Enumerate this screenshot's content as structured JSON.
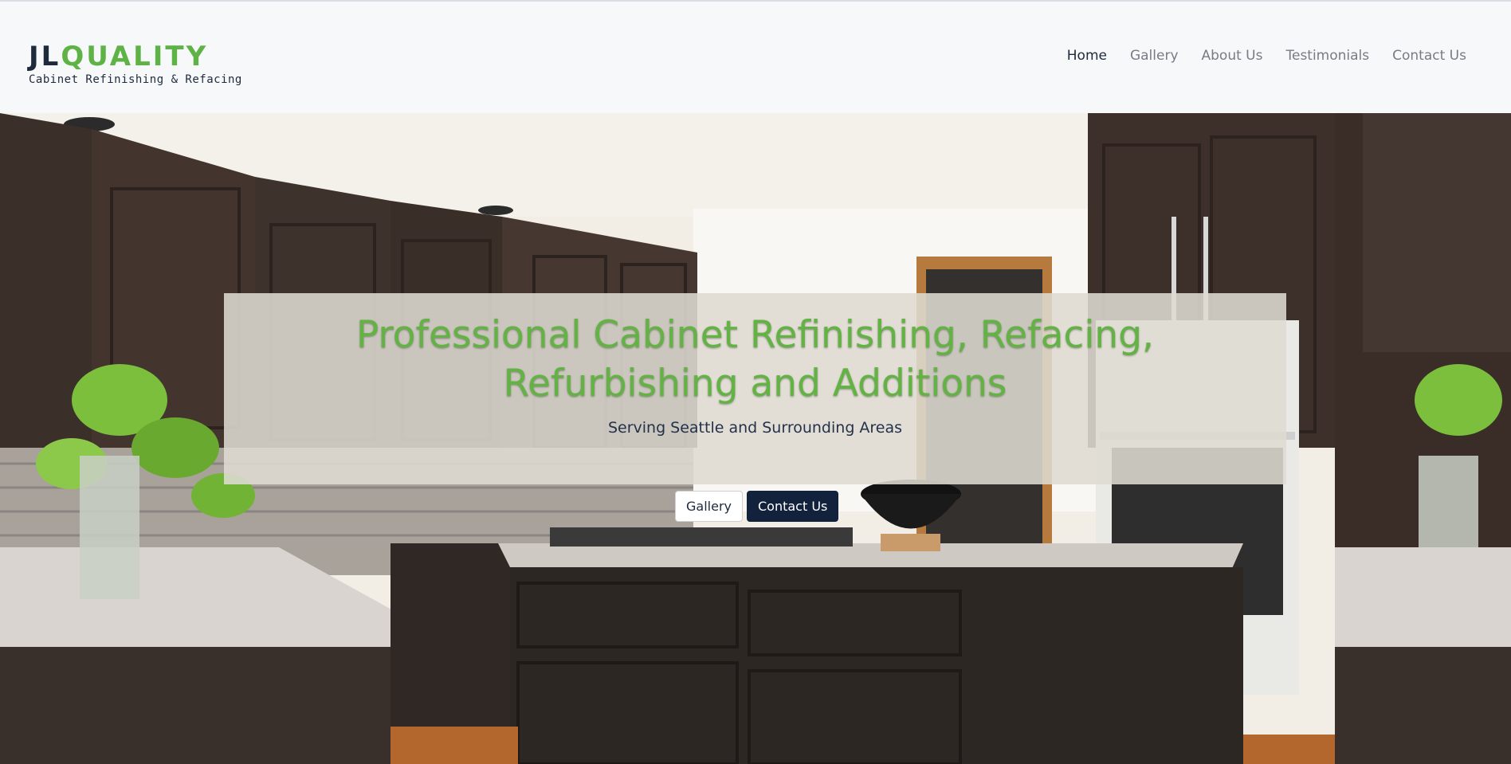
{
  "brand": {
    "logo_primary": "JL",
    "logo_accent": "QUALITY",
    "tagline": "Cabinet Refinishing & Refacing",
    "colors": {
      "navy": "#1e2a3c",
      "green": "#5fb346"
    }
  },
  "nav": {
    "items": [
      {
        "label": "Home",
        "active": true
      },
      {
        "label": "Gallery",
        "active": false
      },
      {
        "label": "About Us",
        "active": false
      },
      {
        "label": "Testimonials",
        "active": false
      },
      {
        "label": "Contact Us",
        "active": false
      }
    ]
  },
  "hero": {
    "headline": "Professional Cabinet Refinishing, Refacing, Refurbishing and Additions",
    "subheadline": "Serving Seattle and Surrounding Areas",
    "buttons": {
      "gallery": "Gallery",
      "contact": "Contact Us"
    },
    "image": "kitchen-photo"
  }
}
